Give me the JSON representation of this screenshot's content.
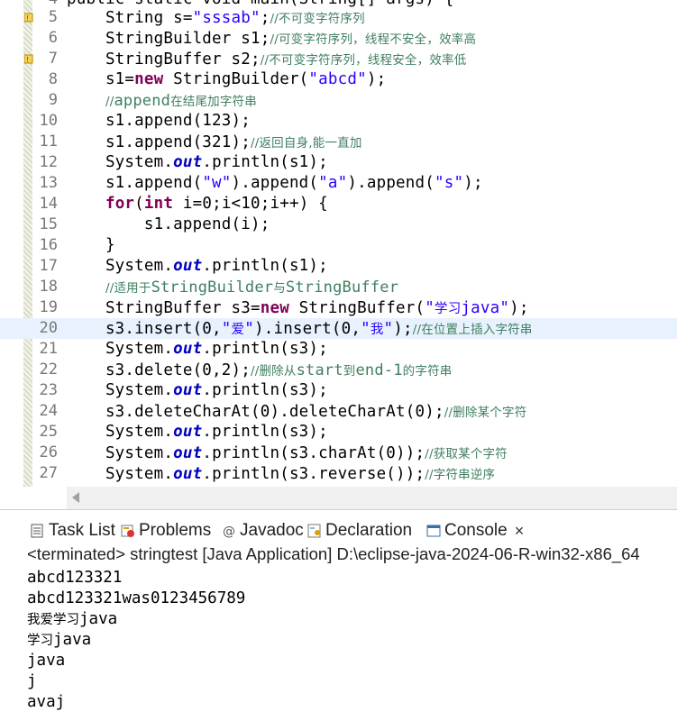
{
  "editor": {
    "partial_top": "public static void main(String[] args) {",
    "lines": [
      {
        "num": "5",
        "code": "    String s=\"sssab\";",
        "comment": "//不可变字符序列",
        "marker": true
      },
      {
        "num": "6",
        "code": "    StringBuilder s1;",
        "comment": "//可变字符序列，线程不安全，效率高"
      },
      {
        "num": "7",
        "code": "    StringBuffer s2;",
        "comment": "//不可变字符序列，线程安全，效率低",
        "marker": true
      },
      {
        "num": "8",
        "code": "    s1=new StringBuilder(\"abcd\");",
        "comment": ""
      },
      {
        "num": "9",
        "code": "    ",
        "comment": "//append在结尾加字符串"
      },
      {
        "num": "10",
        "code": "    s1.append(123);",
        "comment": ""
      },
      {
        "num": "11",
        "code": "    s1.append(321);",
        "comment": "//返回自身,能一直加"
      },
      {
        "num": "12",
        "code": "    System.out.println(s1);",
        "comment": ""
      },
      {
        "num": "13",
        "code": "    s1.append(\"w\").append(\"a\").append(\"s\");",
        "comment": ""
      },
      {
        "num": "14",
        "code": "    for(int i=0;i<10;i++) {",
        "comment": ""
      },
      {
        "num": "15",
        "code": "        s1.append(i);",
        "comment": ""
      },
      {
        "num": "16",
        "code": "    }",
        "comment": ""
      },
      {
        "num": "17",
        "code": "    System.out.println(s1);",
        "comment": ""
      },
      {
        "num": "18",
        "code": "    ",
        "comment": "//适用于StringBuilder与StringBuffer"
      },
      {
        "num": "19",
        "code": "    StringBuffer s3=new StringBuffer(\"学习java\");",
        "comment": ""
      },
      {
        "num": "20",
        "code": "    s3.insert(0,\"爱\").insert(0,\"我\");",
        "comment": "//在位置上插入字符串",
        "current": true
      },
      {
        "num": "21",
        "code": "    System.out.println(s3);",
        "comment": ""
      },
      {
        "num": "22",
        "code": "    s3.delete(0,2);",
        "comment": "//删除从start到end-1的字符串"
      },
      {
        "num": "23",
        "code": "    System.out.println(s3);",
        "comment": ""
      },
      {
        "num": "24",
        "code": "    s3.deleteCharAt(0).deleteCharAt(0);",
        "comment": "//删除某个字符"
      },
      {
        "num": "25",
        "code": "    System.out.println(s3);",
        "comment": ""
      },
      {
        "num": "26",
        "code": "    System.out.println(s3.charAt(0));",
        "comment": "//获取某个字符"
      },
      {
        "num": "27",
        "code": "    System.out.println(s3.reverse());",
        "comment": "//字符串逆序"
      }
    ]
  },
  "tabs": [
    {
      "label": "Task List",
      "icon": "task-list-icon"
    },
    {
      "label": "Problems",
      "icon": "problems-icon"
    },
    {
      "label": "Javadoc",
      "icon": "javadoc-icon"
    },
    {
      "label": "Declaration",
      "icon": "declaration-icon"
    },
    {
      "label": "Console",
      "icon": "console-icon",
      "active": true,
      "close": "×"
    }
  ],
  "console": {
    "header": "<terminated> stringtest [Java Application] D:\\eclipse-java-2024-06-R-win32-x86_64",
    "output": [
      "abcd123321",
      "abcd123321was0123456789",
      "我爱学习java",
      "学习java",
      "java",
      "j",
      "avaj"
    ]
  },
  "colors": {
    "keyword": "#7f0055",
    "string": "#2a00ff",
    "comment": "#3f7f5f",
    "field": "#0000c0",
    "current_line": "#e8f2fe"
  }
}
